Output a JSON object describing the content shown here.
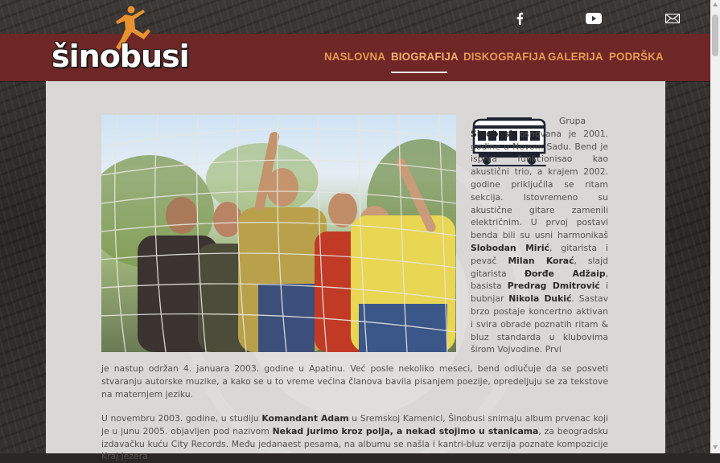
{
  "brand": {
    "name": "šinobusi"
  },
  "social": [
    {
      "icon": "facebook-icon"
    },
    {
      "icon": "youtube-icon"
    },
    {
      "icon": "mail-icon"
    }
  ],
  "nav": {
    "items": [
      {
        "label": "NASLOVNA",
        "active": false
      },
      {
        "label": "BIOGRAFIJA",
        "active": true
      },
      {
        "label": "DISKOGRAFIJA",
        "active": false
      },
      {
        "label": "GALERIJA",
        "active": false
      },
      {
        "label": "PODRŠKA",
        "active": false
      }
    ]
  },
  "article": {
    "intro": {
      "p1": "Grupa ",
      "band": "Šinobusi",
      "p2": " osnovana je 2001. godine u Novom Sadu. Bend je isprva funkcionisao kao akustični trio, a krajem 2002. godine priključila se ritam sekcija. Istovremeno su akustične gitare zamenili električnim. U prvoj postavi benda bili su usni harmonikaš ",
      "m1": "Slobodan Mirić",
      "p3": ", gitarista i pevač ",
      "m2": "Milan Korać",
      "p4": ", slajd gitarista ",
      "m3": "Đorđe Adžaip",
      "p5": ", basista ",
      "m4": "Predrag Dmitrović",
      "p6": " i bubnjar ",
      "m5": "Nikola Dukić",
      "p7": ". Sastav brzo postaje koncertno aktivan i svira obrade poznatih ritam & bluz standarda u klubovima širom Vojvodine. Prvi"
    },
    "continued": "je nastup održan 4. januara 2003. godine u Apatinu. Već posle nekoliko meseci, bend odlučuje da se posveti stvaranju autorske muzike, a kako se u to vreme većina članova bavila pisanjem poezije, opredeljuju se za tekstove na maternjem jeziku.",
    "para2": {
      "p1": "U novembru 2003. godine, u studiju ",
      "studio": "Komandant Adam",
      "p2": " u Sremskoj Kamenici, Šinobusi snimaju album prvenac koji je u junu 2005. objavljen pod nazivom ",
      "album": "Nekad jurimo kroz polja, a nekad stojimo u stanicama",
      "p3": ", za beogradsku izdavačku kuću City Records. Među jedanaest pesama, na albumu se našla i kantri-bluz verzija poznate kompozicije Kraj jezera"
    }
  },
  "colors": {
    "header_bg": "#6e2627",
    "nav_text": "#e79a50",
    "content_bg": "#d9d8d6",
    "logo_runner": "#e8922f"
  }
}
